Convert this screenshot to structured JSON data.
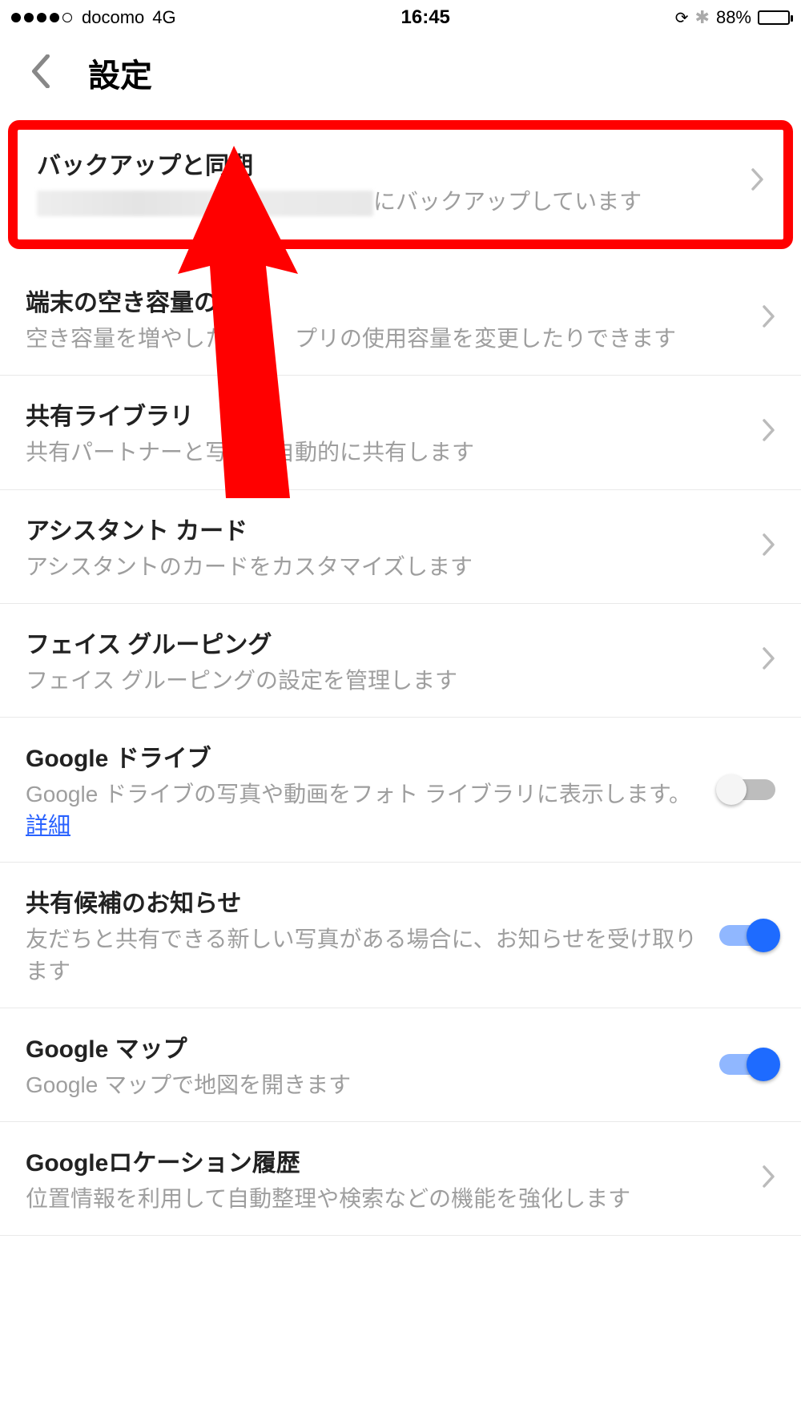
{
  "status": {
    "carrier": "docomo",
    "network": "4G",
    "time": "16:45",
    "battery_pct": "88%"
  },
  "nav": {
    "title": "設定"
  },
  "items": {
    "backup": {
      "title": "バックアップと同期",
      "sub_suffix": "にバックアップしています"
    },
    "storage": {
      "title": "端末の空き容量の管",
      "sub": "空き容量を増やした　　　プリの使用容量を変更したりできます"
    },
    "shared_lib": {
      "title": "共有ライブラリ",
      "sub": "共有パートナーと写真を自動的に共有します"
    },
    "assistant": {
      "title": "アシスタント カード",
      "sub": "アシスタントのカードをカスタマイズします"
    },
    "face": {
      "title": "フェイス グルーピング",
      "sub": "フェイス グルーピングの設定を管理します"
    },
    "drive": {
      "title": "Google ドライブ",
      "sub": "Google ドライブの写真や動画をフォト ライブラリに表示します。",
      "link": "詳細"
    },
    "share_suggest": {
      "title": "共有候補のお知らせ",
      "sub": "友だちと共有できる新しい写真がある場合に、お知らせを受け取ります"
    },
    "maps": {
      "title": "Google マップ",
      "sub": "Google マップで地図を開きます"
    },
    "location": {
      "title": "Googleロケーション履歴",
      "sub": "位置情報を利用して自動整理や検索などの機能を強化します"
    }
  }
}
